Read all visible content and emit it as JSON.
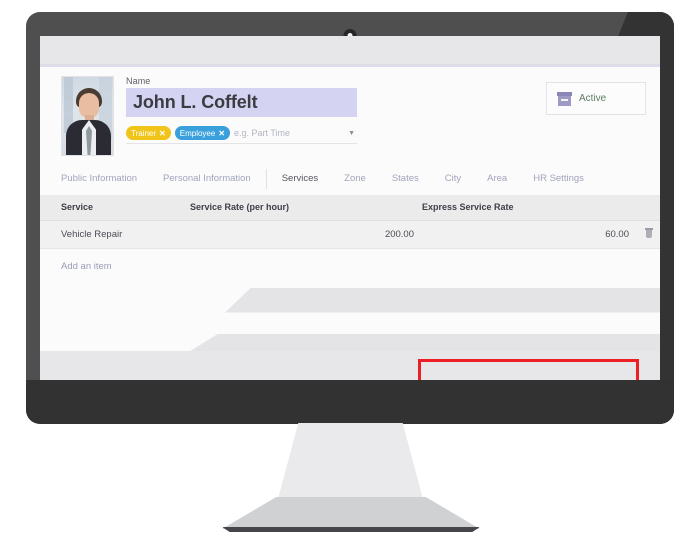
{
  "device": {
    "type": "desktop-monitor",
    "webcam_icon": "webcam-dot-icon"
  },
  "record": {
    "photo_alt": "employee-portrait",
    "name_label": "Name",
    "name_value": "John L. Coffelt",
    "tags": [
      {
        "label": "Trainer",
        "color": "#f0c419",
        "remove_icon": "✕"
      },
      {
        "label": "Employee",
        "color": "#3aa0dc",
        "remove_icon": "✕"
      }
    ],
    "tags_placeholder": "e.g. Part Time",
    "tags_caret_icon": "▼",
    "status": {
      "icon": "archive-box-icon",
      "label": "Active",
      "color": "#5e7d62"
    }
  },
  "tabs": [
    {
      "label": "Public Information",
      "active": false
    },
    {
      "label": "Personal Information",
      "active": false
    },
    {
      "label": "Services",
      "active": true
    },
    {
      "label": "Zone",
      "active": false
    },
    {
      "label": "States",
      "active": false
    },
    {
      "label": "City",
      "active": false
    },
    {
      "label": "Area",
      "active": false
    },
    {
      "label": "HR Settings",
      "active": false
    }
  ],
  "services_table": {
    "columns": [
      "Service",
      "Service Rate (per hour)",
      "Express Service Rate",
      ""
    ],
    "rows": [
      {
        "service": "Vehicle Repair",
        "service_rate": "200.00",
        "express_service_rate": "60.00",
        "delete_icon": "trash-icon"
      }
    ],
    "add_item_label": "Add an item"
  },
  "annotation": {
    "type": "highlight-rectangle",
    "color": "#ec2024",
    "targets": "Express Service Rate column header and value"
  },
  "theme": {
    "bezel": "#4f4f4f",
    "bezel_shadow": "#333333",
    "screen_bg": "#fbfbfc",
    "band_bg": "#e7e7e9",
    "name_field_bg": "#d5d3f2",
    "table_header_bg": "#ebebec",
    "table_row_bg": "#f1f1f2",
    "muted_text": "#a2a4bb",
    "active_tab_text": "#55565e"
  }
}
